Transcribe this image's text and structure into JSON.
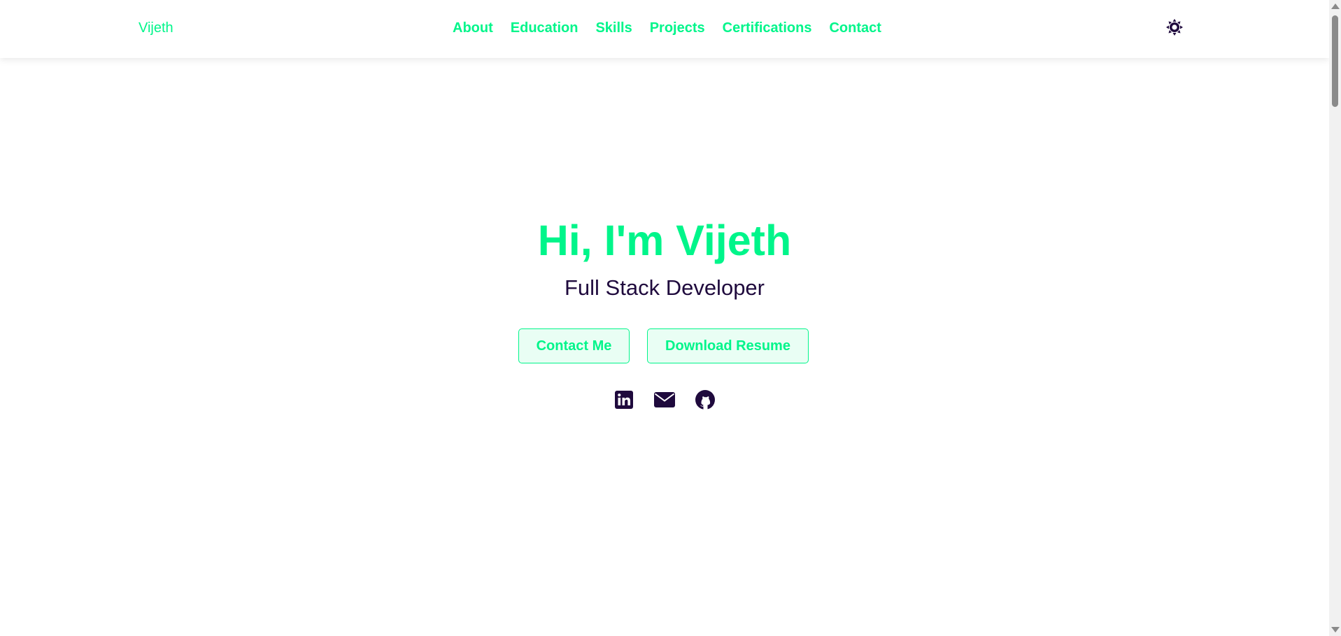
{
  "nav": {
    "brand": "Vijeth",
    "links": [
      "About",
      "Education",
      "Skills",
      "Projects",
      "Certifications",
      "Contact"
    ],
    "theme_toggle_icon": "sun-icon"
  },
  "hero": {
    "title": "Hi, I'm Vijeth",
    "subtitle": "Full Stack Developer",
    "contact_button": "Contact Me",
    "resume_button": "Download Resume"
  },
  "socials": [
    "linkedin-icon",
    "envelope-icon",
    "github-icon"
  ],
  "colors": {
    "accent": "#00f58a",
    "button_bg": "#e9fef4",
    "dark_text": "#1f0a3d",
    "background": "#ffffff"
  }
}
